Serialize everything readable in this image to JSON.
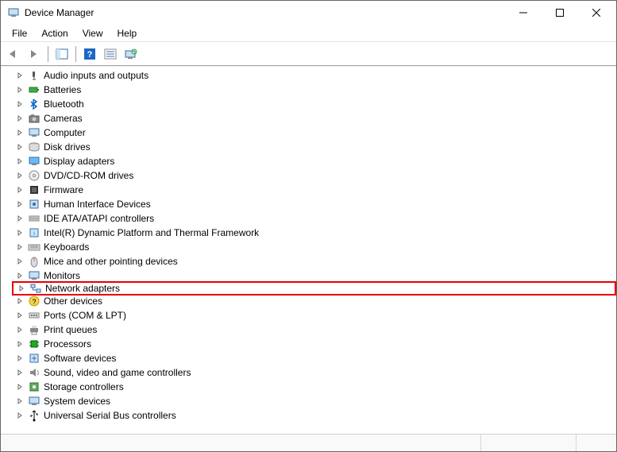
{
  "window": {
    "title": "Device Manager"
  },
  "menu": {
    "items": [
      "File",
      "Action",
      "View",
      "Help"
    ]
  },
  "toolbar": {
    "buttons": [
      {
        "name": "back-icon"
      },
      {
        "name": "forward-icon"
      },
      {
        "name": "show-hide-tree-icon"
      },
      {
        "name": "help-icon"
      },
      {
        "name": "properties-icon"
      },
      {
        "name": "scan-hardware-icon"
      }
    ]
  },
  "tree": {
    "items": [
      {
        "label": "Audio inputs and outputs",
        "icon": "audio-icon"
      },
      {
        "label": "Batteries",
        "icon": "battery-icon"
      },
      {
        "label": "Bluetooth",
        "icon": "bluetooth-icon"
      },
      {
        "label": "Cameras",
        "icon": "camera-icon"
      },
      {
        "label": "Computer",
        "icon": "computer-icon"
      },
      {
        "label": "Disk drives",
        "icon": "disk-icon"
      },
      {
        "label": "Display adapters",
        "icon": "display-icon"
      },
      {
        "label": "DVD/CD-ROM drives",
        "icon": "dvd-icon"
      },
      {
        "label": "Firmware",
        "icon": "firmware-icon"
      },
      {
        "label": "Human Interface Devices",
        "icon": "hid-icon"
      },
      {
        "label": "IDE ATA/ATAPI controllers",
        "icon": "ide-icon"
      },
      {
        "label": "Intel(R) Dynamic Platform and Thermal Framework",
        "icon": "intel-icon"
      },
      {
        "label": "Keyboards",
        "icon": "keyboard-icon"
      },
      {
        "label": "Mice and other pointing devices",
        "icon": "mouse-icon"
      },
      {
        "label": "Monitors",
        "icon": "monitor-icon"
      },
      {
        "label": "Network adapters",
        "icon": "network-icon",
        "highlighted": true
      },
      {
        "label": "Other devices",
        "icon": "other-icon"
      },
      {
        "label": "Ports (COM & LPT)",
        "icon": "ports-icon"
      },
      {
        "label": "Print queues",
        "icon": "printer-icon"
      },
      {
        "label": "Processors",
        "icon": "cpu-icon"
      },
      {
        "label": "Software devices",
        "icon": "software-icon"
      },
      {
        "label": "Sound, video and game controllers",
        "icon": "sound-icon"
      },
      {
        "label": "Storage controllers",
        "icon": "storage-icon"
      },
      {
        "label": "System devices",
        "icon": "system-icon"
      },
      {
        "label": "Universal Serial Bus controllers",
        "icon": "usb-icon"
      }
    ]
  }
}
